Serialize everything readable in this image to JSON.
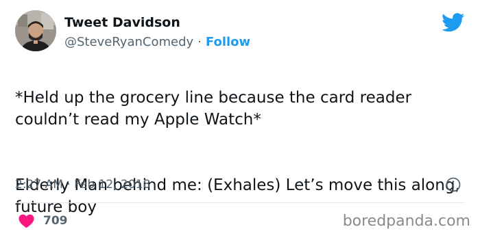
{
  "author": {
    "name": "Tweet Davidson",
    "handle": "@SteveRyanComedy",
    "separator": "·",
    "follow_label": "Follow"
  },
  "tweet": {
    "paragraph_1": "*Held up the grocery line because the card reader couldn’t read my Apple Watch*",
    "paragraph_2": "Elderly Man behind me: (Exhales) Let’s move this along, future boy",
    "timestamp": "2:27 AM · Feb 12, 2018"
  },
  "stats": {
    "likes": "709"
  },
  "watermark": "boredpanda.com",
  "icons": {
    "brand": "twitter-bird-icon",
    "info": "info-icon",
    "like": "heart-icon"
  },
  "colors": {
    "brand_blue": "#1d9bf0",
    "like_pink": "#f91880",
    "secondary_text": "#536471",
    "primary_text": "#0f1419"
  }
}
